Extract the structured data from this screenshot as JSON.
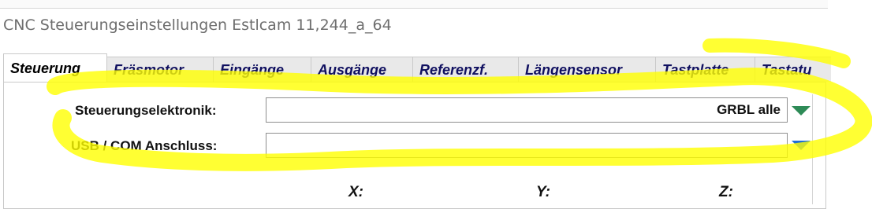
{
  "window": {
    "title": "CNC Steuerungseinstellungen Estlcam 11,244_a_64"
  },
  "tabs": [
    {
      "label": "Steuerung",
      "active": true
    },
    {
      "label": "Fräsmotor"
    },
    {
      "label": "Eingänge"
    },
    {
      "label": "Ausgänge"
    },
    {
      "label": "Referenzf."
    },
    {
      "label": "Längensensor"
    },
    {
      "label": "Tastplatte"
    },
    {
      "label": "Tastatu"
    }
  ],
  "settings": {
    "controller_label": "Steuerungselektronik:",
    "controller_value": "GRBL alle",
    "port_label": "USB / COM Anschluss:",
    "port_value": ""
  },
  "axes": {
    "x": "X:",
    "y": "Y:",
    "z": "Z:"
  },
  "colors": {
    "highlight": "#ffff00",
    "arrow_green": "#2e8b57",
    "arrow_blue": "#1e6fd9"
  }
}
